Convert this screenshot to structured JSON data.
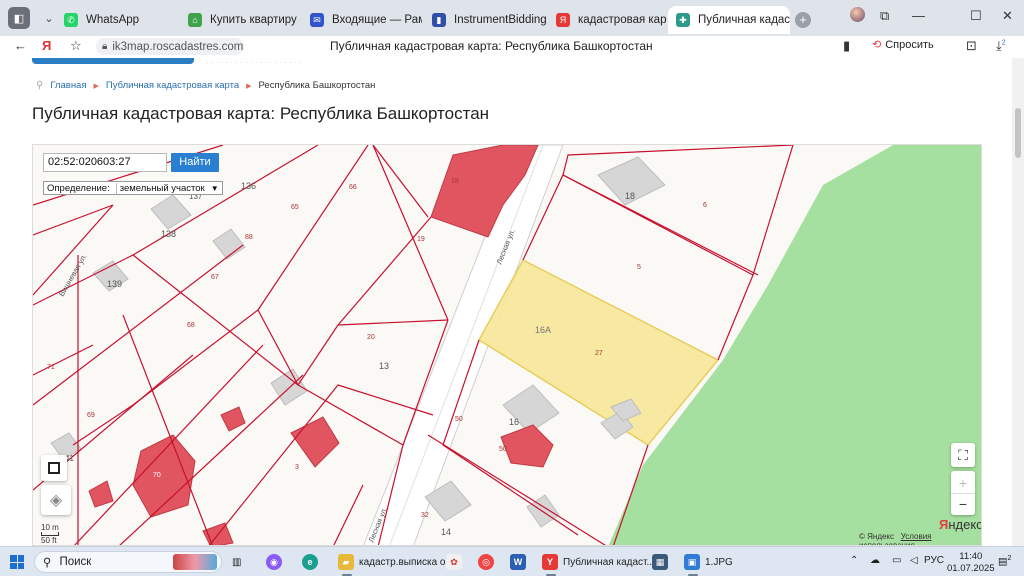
{
  "browser": {
    "tabs": [
      {
        "label": "WhatsApp",
        "fav_color": "#25d366",
        "fav_glyph": "✆"
      },
      {
        "label": "Купить квартиру во вт",
        "fav_color": "#3fa34d",
        "fav_glyph": "⌂"
      },
      {
        "label": "Входящие — Рамблер",
        "fav_color": "#3355cc",
        "fav_glyph": "✉"
      },
      {
        "label": "InstrumentBidding",
        "fav_color": "#2f4fa8",
        "fav_glyph": "▮"
      },
      {
        "label": "кадастровая карта по",
        "fav_color": "#e53935",
        "fav_glyph": "Я"
      },
      {
        "label": "Публичная кадастр",
        "fav_color": "#2e9a8c",
        "fav_glyph": "✚"
      }
    ],
    "url": "ik3map.roscadastres.com",
    "page_title": "Публичная кадастровая карта: Республика Башкортостан",
    "ask_label": "Спросить",
    "downloads_badge": "2",
    "accent": "#2b7fd1"
  },
  "page": {
    "breadcrumb": {
      "home": "Главная",
      "parent": "Публичная кадастровая карта",
      "current": "Республика Башкортостан"
    },
    "heading": "Публичная кадастровая карта: Республика Башкортостан"
  },
  "map": {
    "search_value": "02:52:020603:27",
    "search_button": "Найти",
    "definition_label": "Определение:",
    "definition_value": "земельный участок",
    "scale_m": "10 m",
    "scale_ft": "50 ft",
    "copyright": "© Яндекс",
    "terms": "Условия использования",
    "logo_first": "Я",
    "logo_rest": "ндекс",
    "parcel_highlight_color": "#f7e79a",
    "boundary_color": "#c8102e",
    "forest_color": "#a6e0a0",
    "building_color": "#e0555f",
    "labels": {
      "n136": "136",
      "n137": "137",
      "n66": "66",
      "n65": "65",
      "n138": "138",
      "n88": "88",
      "n139": "139",
      "n67": "67",
      "n68": "68",
      "n71": "71",
      "n69": "69",
      "n41": "41",
      "n18a": "18",
      "n19": "19",
      "n20": "20",
      "n13": "13",
      "n16A": "16А",
      "n27": "27",
      "n5": "5",
      "n6": "6",
      "n18b": "18",
      "n50a": "50",
      "n16": "16",
      "n50b": "50",
      "n32": "32",
      "n14": "14",
      "n70": "70",
      "n3": "3",
      "street1": "Лесная ул.",
      "street2": "Вишневая ул.",
      "street3": "Лесная ул."
    }
  },
  "taskbar": {
    "search_label": "Поиск",
    "apps": [
      {
        "label": "кадастр.выписка о...",
        "color": "#e8b83a",
        "glyph": "▰"
      },
      {
        "label": "Публичная кадаст...",
        "color": "#e53935",
        "glyph": "Y"
      },
      {
        "label": "1.JPG",
        "color": "#2f7bd6",
        "glyph": "▣"
      }
    ],
    "lang": "РУС",
    "time": "11:40",
    "date": "01.07.2025",
    "notif_count": "2"
  }
}
